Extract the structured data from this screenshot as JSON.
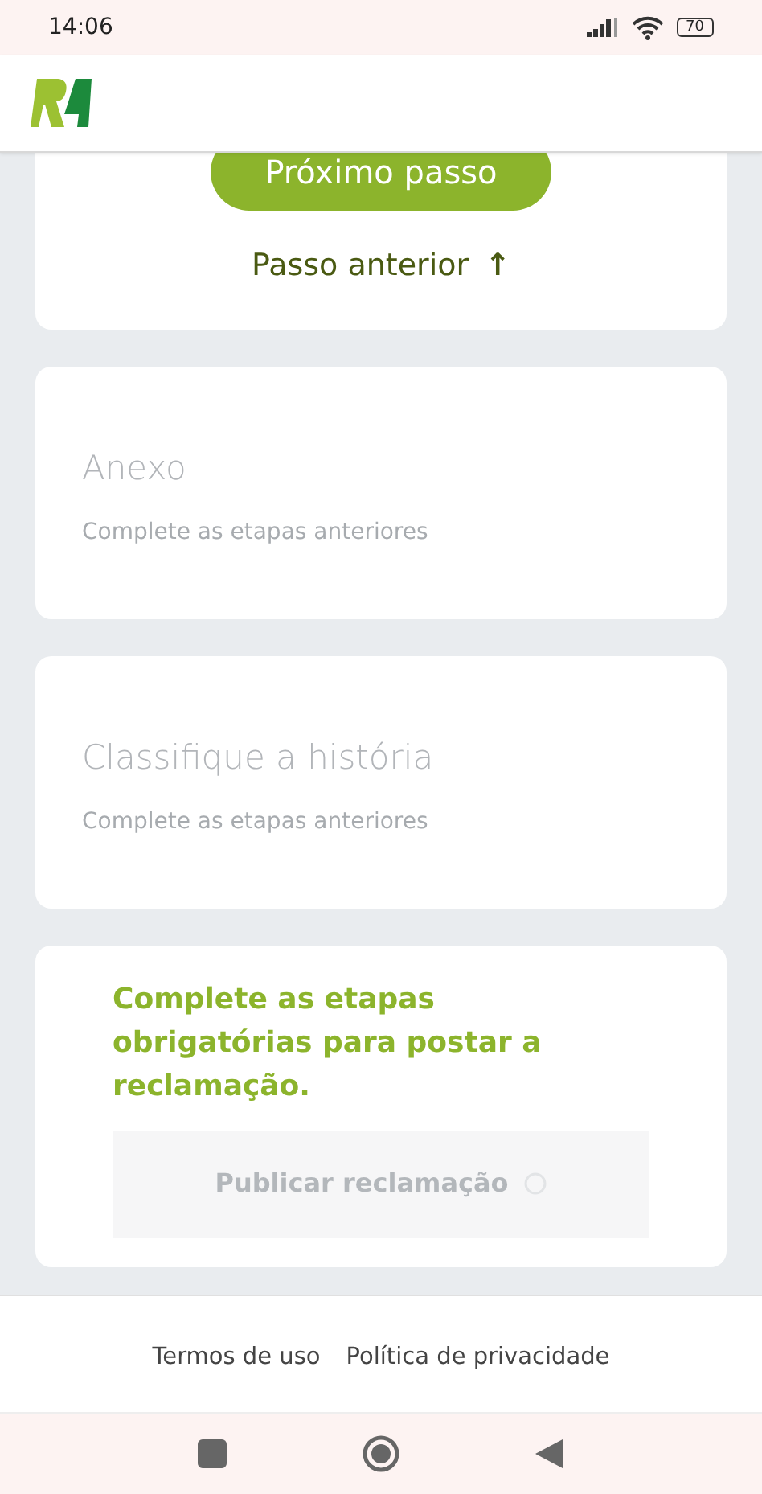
{
  "status_bar": {
    "time": "14:06",
    "battery": "70"
  },
  "step_card": {
    "next_button": "Próximo passo",
    "previous_link": "Passo anterior",
    "previous_icon": "↑"
  },
  "steps": [
    {
      "title": "Anexo",
      "subtitle": "Complete as etapas anteriores"
    },
    {
      "title": "Classifique a história",
      "subtitle": "Complete as etapas anteriores"
    }
  ],
  "publish_card": {
    "message": "Complete as etapas obrigatórias para postar a reclamação.",
    "button": "Publicar reclamação",
    "disabled": true
  },
  "footer_links": [
    "Termos de uso",
    "Política de privacidade"
  ]
}
